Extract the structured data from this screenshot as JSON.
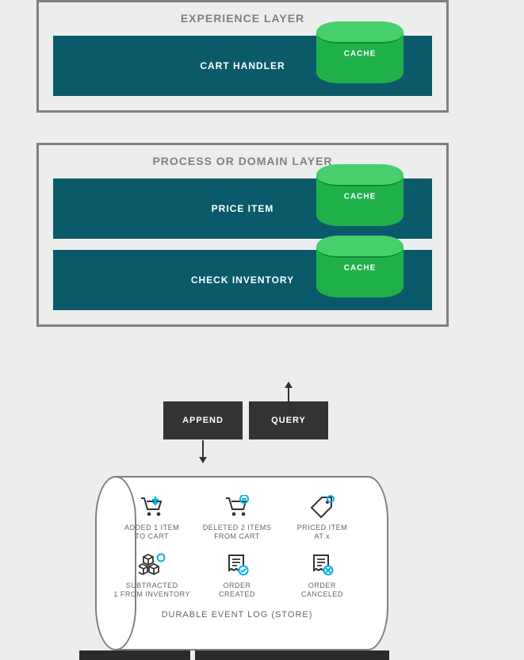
{
  "layers": {
    "experience": {
      "title": "EXPERIENCE LAYER",
      "items": [
        {
          "label": "CART HANDLER",
          "cache": "CACHE"
        }
      ]
    },
    "process": {
      "title": "PROCESS OR DOMAIN LAYER",
      "items": [
        {
          "label": "PRICE ITEM",
          "cache": "CACHE"
        },
        {
          "label": "CHECK INVENTORY",
          "cache": "CACHE"
        }
      ]
    }
  },
  "actions": {
    "append": "APPEND",
    "query": "QUERY"
  },
  "event_log": {
    "title": "DURABLE EVENT LOG (STORE)",
    "events": [
      {
        "icon": "cart-add-icon",
        "label": "ADDED 1 ITEM\nTO CART"
      },
      {
        "icon": "cart-remove-icon",
        "label": "DELETED 2 ITEMS\nFROM CART"
      },
      {
        "icon": "tag-icon",
        "label": "PRICED ITEM\nAT x"
      },
      {
        "icon": "boxes-icon",
        "label": "SUBTRACTED\n1 FROM INVENTORY"
      },
      {
        "icon": "order-ok-icon",
        "label": "ORDER\nCREATED"
      },
      {
        "icon": "order-cancel-icon",
        "label": "ORDER\nCANCELED"
      }
    ]
  }
}
